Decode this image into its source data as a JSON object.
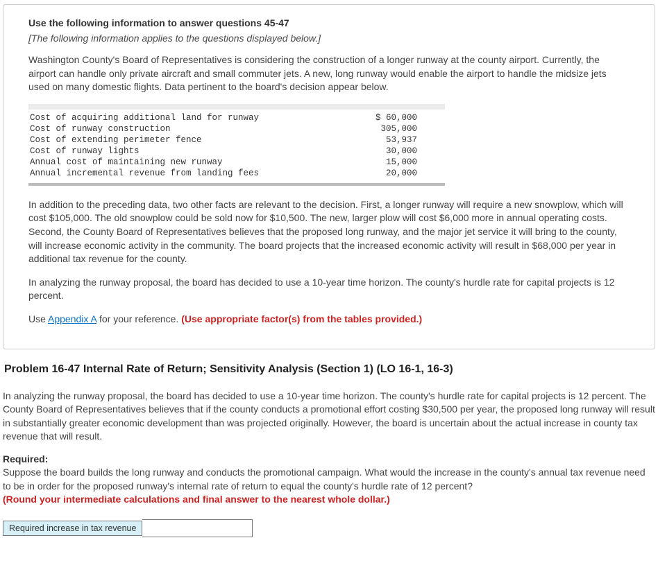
{
  "info": {
    "header": "Use the following information to answer questions 45-47",
    "note": "[The following information applies to the questions displayed below.]",
    "intro": "Washington County's Board of Representatives is considering the construction of a longer runway at the county airport. Currently, the airport can handle only private aircraft and small commuter jets. A new, long runway would enable the airport to handle the midsize jets used on many domestic flights. Data pertinent to the board's decision appear below.",
    "table": [
      {
        "label": "Cost of acquiring additional land for runway",
        "value": "$ 60,000"
      },
      {
        "label": "Cost of runway construction",
        "value": "305,000"
      },
      {
        "label": "Cost of extending perimeter fence",
        "value": "53,937"
      },
      {
        "label": "Cost of runway lights",
        "value": "30,000"
      },
      {
        "label": "Annual cost of maintaining new runway",
        "value": "15,000"
      },
      {
        "label": "Annual incremental revenue from landing fees",
        "value": "20,000"
      }
    ],
    "para2": "In addition to the preceding data, two other facts are relevant to the decision. First, a longer runway will require a new snowplow, which will cost $105,000. The old snowplow could be sold now for $10,500. The new, larger plow will cost $6,000 more in annual operating costs. Second, the County Board of Representatives believes that the proposed long runway, and the major jet service it will bring to the county, will increase economic activity in the community. The board projects that the increased economic activity will result in $68,000 per year in additional tax revenue for the county.",
    "para3": "In analyzing the runway proposal, the board has decided to use a 10-year time horizon. The county's hurdle rate for capital projects is 12 percent.",
    "appendix_prefix": "Use ",
    "appendix_link": "Appendix A",
    "appendix_suffix": " for your reference. ",
    "appendix_red": "(Use appropriate factor(s) from the tables provided.)"
  },
  "problem": {
    "title": "Problem 16-47 Internal Rate of Return; Sensitivity Analysis (Section 1) (LO 16-1, 16-3)",
    "para1": "In analyzing the runway proposal, the board has decided to use a 10-year time horizon. The county's hurdle rate for capital projects is 12 percent. The County Board of Representatives believes that if the county conducts a promotional effort costing $30,500 per year, the proposed long runway will result in substantially greater economic development than was projected originally. However, the board is uncertain about the actual increase in county tax revenue that will result.",
    "required_label": "Required:",
    "required_text": "Suppose the board builds the long runway and conducts the promotional campaign. What would the increase in the county's annual tax revenue need to be in order for the proposed runway's internal rate of return to equal the county's hurdle rate of 12 percent?",
    "required_red": "(Round your intermediate calculations and final answer to the nearest whole dollar.)",
    "answer_label": "Required increase in tax revenue",
    "answer_value": ""
  }
}
